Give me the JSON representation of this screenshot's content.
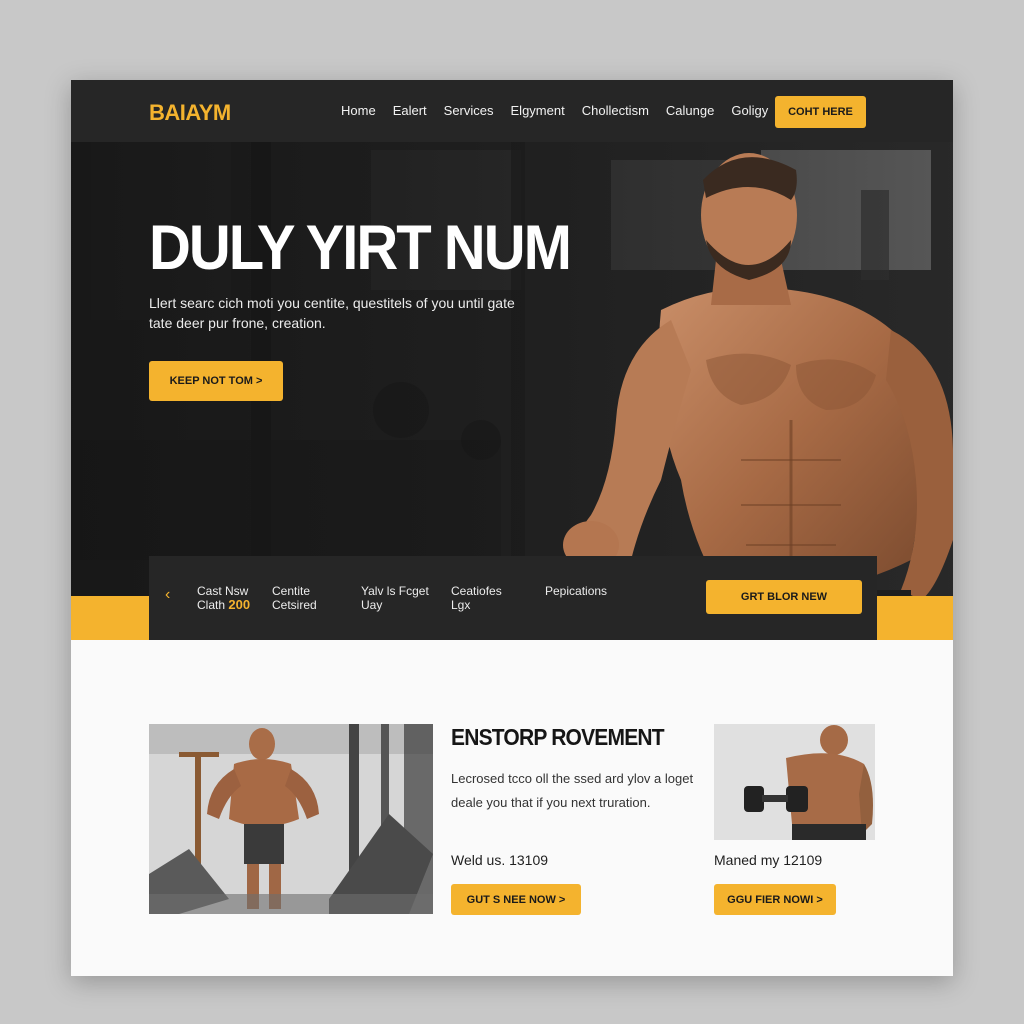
{
  "brand": {
    "logo": "BAIAYM",
    "accent": "#f4b32e"
  },
  "nav": {
    "items": [
      "Home",
      "Ealert",
      "Services",
      "Elgyment",
      "Chollectism",
      "Calunge",
      "Goligy"
    ],
    "contact_label": "COHT HERE"
  },
  "hero": {
    "title": "DULY YIRT NUM",
    "text": "Llert searc cich moti you centite, questitels of you until gate tate deer pur frone, creation.",
    "button_label": "KEEP NOT TOM >"
  },
  "strip": {
    "arrow_icon": "chevron-left-icon",
    "items": [
      {
        "line1": "Cast Nsw",
        "line2": "Clath",
        "accent": "200"
      },
      {
        "line1": "Centite",
        "line2": "Cetsired",
        "accent": ""
      },
      {
        "line1": "Yalv ls Fcget",
        "line2": "Uay",
        "accent": ""
      },
      {
        "line1": "Ceatiofes",
        "line2": "Lgx",
        "accent": ""
      },
      {
        "line1": "Pepications",
        "line2": "",
        "accent": ""
      }
    ],
    "button_label": "GRT BLOR NEW"
  },
  "section": {
    "title": "ENSTORP ROVEMENT",
    "text": "Lecrosed tcco oll the ssed ard ylov a loget deale you that if you next truration.",
    "left_price": "Weld us. 13109",
    "left_button": "GUT S NEE NOW >",
    "right_price": "Maned my 12109",
    "right_button": "GGU FIER NOWI >"
  }
}
